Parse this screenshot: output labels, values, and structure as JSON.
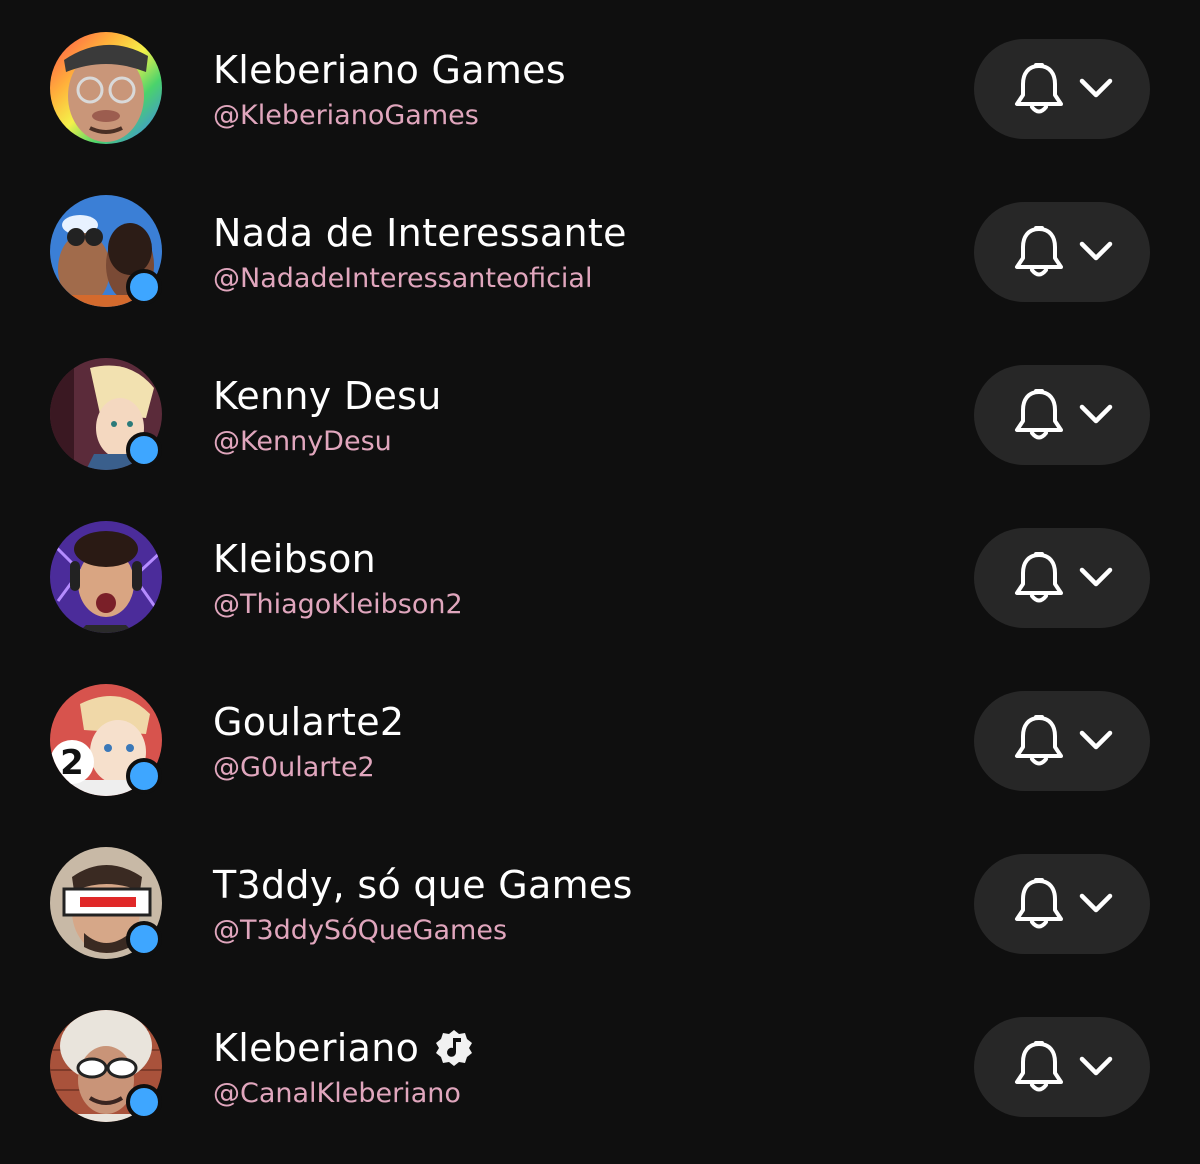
{
  "subscriptions": [
    {
      "name": "Kleberiano Games",
      "handle": "@KleberianoGames",
      "has_new": false,
      "verified": false,
      "avatar": "avatar-kleberiano-games"
    },
    {
      "name": "Nada de Interessante",
      "handle": "@NadadeInteressanteoficial",
      "has_new": true,
      "verified": false,
      "avatar": "avatar-nada-de-interessante"
    },
    {
      "name": "Kenny Desu",
      "handle": "@KennyDesu",
      "has_new": true,
      "verified": false,
      "avatar": "avatar-kenny-desu"
    },
    {
      "name": "Kleibson",
      "handle": "@ThiagoKleibson2",
      "has_new": false,
      "verified": false,
      "avatar": "avatar-kleibson"
    },
    {
      "name": "Goularte2",
      "handle": "@G0ularte2",
      "has_new": true,
      "verified": false,
      "avatar": "avatar-goularte2"
    },
    {
      "name": "T3ddy, só que Games",
      "handle": "@T3ddySóQueGames",
      "has_new": true,
      "verified": false,
      "avatar": "avatar-t3ddy"
    },
    {
      "name": "Kleberiano",
      "handle": "@CanalKleberiano",
      "has_new": true,
      "verified": true,
      "avatar": "avatar-kleberiano"
    }
  ],
  "colors": {
    "background": "#0f0f0f",
    "button": "#272727",
    "new_dot": "#3ea6ff",
    "handle": "#e0a6bd",
    "text": "#ffffff"
  },
  "icons": {
    "notification_button": "bell-icon",
    "dropdown": "chevron-down-icon",
    "verified": "music-note-badge-icon"
  }
}
